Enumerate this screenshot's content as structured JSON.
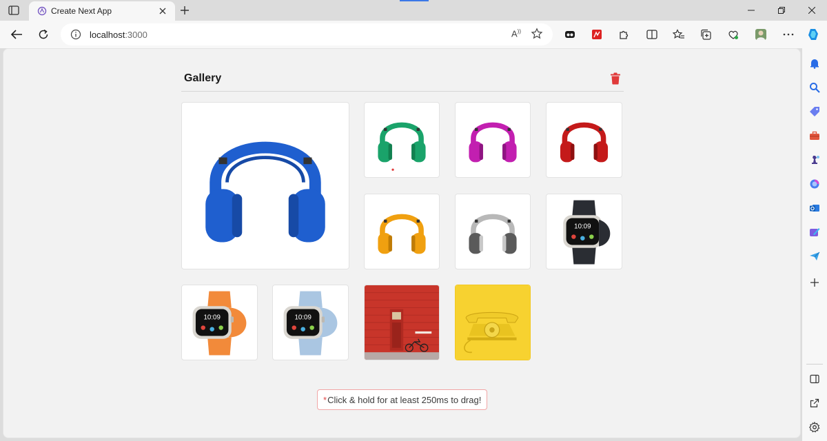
{
  "browser": {
    "tab_title": "Create Next App",
    "url_host": "localhost",
    "url_port": ":3000",
    "read_aloud_label": "A",
    "accent": "#3b78e7"
  },
  "page": {
    "title": "Gallery",
    "hint_marker": "*",
    "hint_text": "Click & hold for at least 250ms to drag!",
    "danger_color": "#e03a3a"
  },
  "gallery": {
    "items": [
      {
        "kind": "headphones",
        "color": "#1f5fcf"
      },
      {
        "kind": "headphones",
        "color": "#1aa36a"
      },
      {
        "kind": "headphones",
        "color": "#c21fb0"
      },
      {
        "kind": "headphones",
        "color": "#c41a1a"
      },
      {
        "kind": "headphones",
        "color": "#f0a010"
      },
      {
        "kind": "headphones",
        "color": "#b8b8b8"
      },
      {
        "kind": "watch",
        "color": "#2a2d33"
      },
      {
        "kind": "watch",
        "color": "#f28a3a"
      },
      {
        "kind": "watch",
        "color": "#aac6e2"
      },
      {
        "kind": "red-wall-bicycle",
        "color": "#c8352a"
      },
      {
        "kind": "yellow-telephone",
        "color": "#f7d230"
      }
    ]
  }
}
